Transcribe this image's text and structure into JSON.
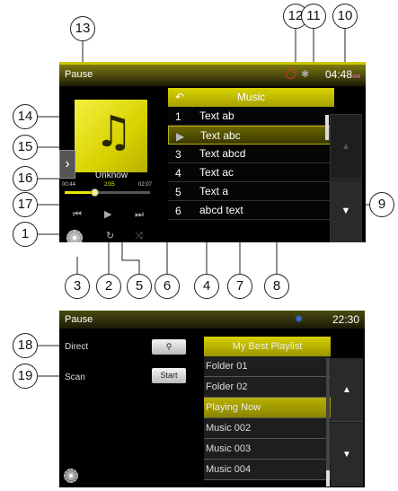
{
  "callouts": [
    "1",
    "2",
    "3",
    "4",
    "5",
    "6",
    "7",
    "8",
    "9",
    "10",
    "11",
    "12",
    "13",
    "14",
    "15",
    "16",
    "17",
    "18",
    "19"
  ],
  "screen1": {
    "status": "Pause",
    "clock": "04:48",
    "clock_suffix": "AM",
    "now_playing": {
      "title": "Unknow",
      "elapsed": "00:44",
      "total": "02:07",
      "track_count": "2/35",
      "progress": 0.35
    },
    "icons": {
      "side_menu": "chevron-right-icon",
      "prev": "previous-track-icon",
      "play": "play-icon",
      "next": "next-track-icon",
      "settings": "gear-icon",
      "repeat": "repeat-icon",
      "shuffle": "shuffle-icon",
      "back": "back-arrow-icon",
      "bluetooth": "bluetooth-icon",
      "sync": "sync-icon"
    },
    "list": {
      "header": "Music",
      "items": [
        {
          "num": "1",
          "title": "Text ab"
        },
        {
          "num": "▶",
          "title": "Text abc",
          "selected": true
        },
        {
          "num": "3",
          "title": "Text abcd"
        },
        {
          "num": "4",
          "title": "Text ac"
        },
        {
          "num": "5",
          "title": "Text a"
        },
        {
          "num": "6",
          "title": "abcd text"
        }
      ]
    },
    "scroll": {
      "up": "▲",
      "down": "▼"
    }
  },
  "screen2": {
    "status": "Pause",
    "clock": "22:30",
    "options": [
      {
        "label": "Direct",
        "button": "⚲"
      },
      {
        "label": "Scan",
        "button": "Start"
      }
    ],
    "list": {
      "header": "My Best Playlist",
      "items": [
        "Folder 01",
        "Folder 02",
        "Playing Now",
        "Music 002",
        "Music 003",
        "Music 004"
      ],
      "selected_index": 2
    },
    "scroll": {
      "up": "▲",
      "down": "▼"
    }
  },
  "colors": {
    "accent": "#d8d200",
    "background": "#000000"
  }
}
